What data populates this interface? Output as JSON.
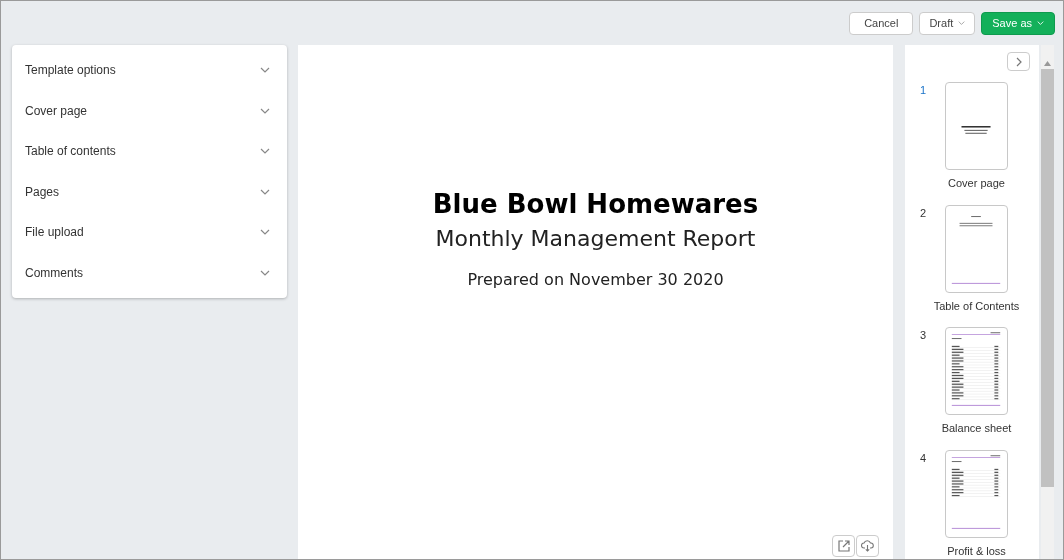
{
  "toolbar": {
    "cancel": "Cancel",
    "draft": "Draft",
    "save": "Save as"
  },
  "sections": [
    {
      "label": "Template options",
      "expanded": false
    },
    {
      "label": "Cover page",
      "expanded": false
    },
    {
      "label": "Table of contents",
      "expanded": false
    },
    {
      "label": "Pages",
      "expanded": false
    },
    {
      "label": "File upload",
      "expanded": false
    },
    {
      "label": "Comments",
      "expanded": false
    }
  ],
  "preview": {
    "title": "Blue Bowl Homewares",
    "subtitle": "Monthly Management Report",
    "date": "Prepared on November 30 2020"
  },
  "thumbnails": [
    {
      "number": "1",
      "label": "Cover page",
      "kind": "cover",
      "selected": true
    },
    {
      "number": "2",
      "label": "Table of Contents",
      "kind": "toc",
      "selected": false
    },
    {
      "number": "3",
      "label": "Balance sheet",
      "kind": "long-table",
      "selected": false
    },
    {
      "number": "4",
      "label": "Profit & loss",
      "kind": "short-table",
      "selected": false
    }
  ]
}
